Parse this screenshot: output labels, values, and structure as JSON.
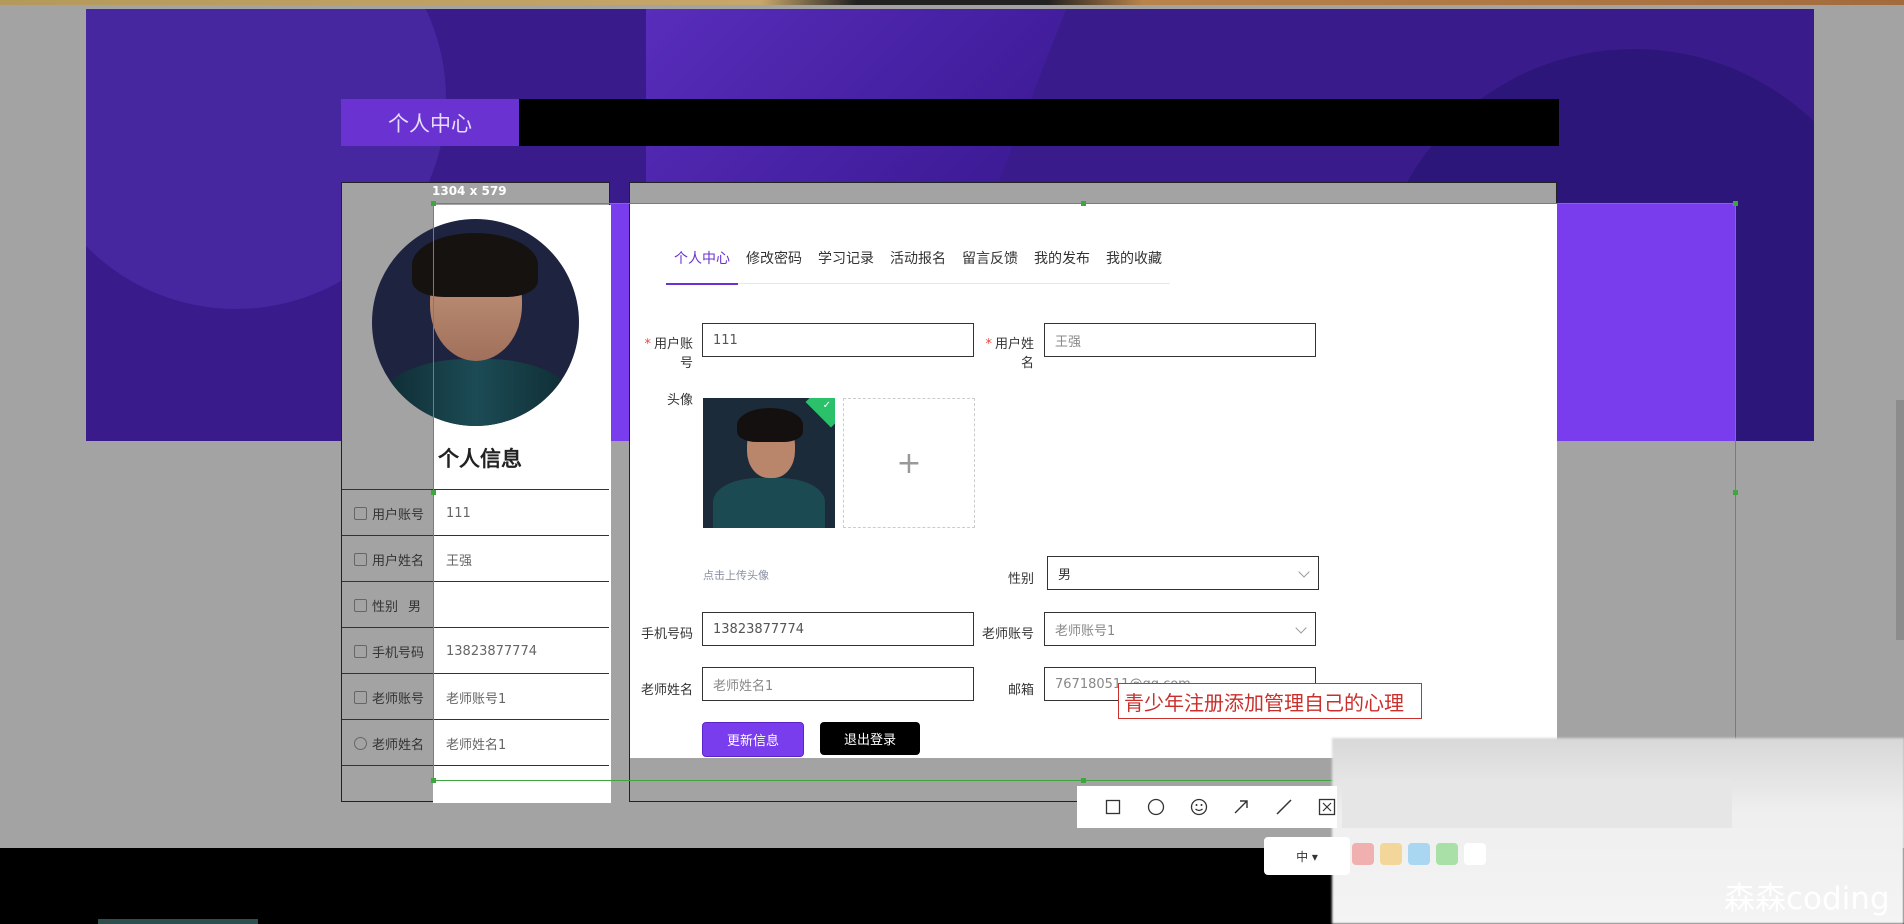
{
  "header": {
    "title": "个人中心"
  },
  "screenshot_tool": {
    "size_label": "1304 x 579",
    "annotation_text": "青少年注册添加管理自己的心理",
    "toolbar_icons": [
      "rectangle-icon",
      "circle-icon",
      "emoji-icon",
      "arrow-icon",
      "line-icon",
      "mosaic-icon"
    ],
    "lang_label": "中 ▾"
  },
  "profile": {
    "section_title": "个人信息",
    "rows": [
      {
        "label": "用户账号",
        "value": "111",
        "icon": "user-icon"
      },
      {
        "label": "用户姓名",
        "value": "王强",
        "icon": "id-card-icon"
      },
      {
        "label": "性别",
        "value": "男",
        "icon": "chat-icon"
      },
      {
        "label": "手机号码",
        "value": "13823877774",
        "icon": "edit-icon"
      },
      {
        "label": "老师账号",
        "value": "老师账号1",
        "icon": "person-icon"
      },
      {
        "label": "老师姓名",
        "value": "老师姓名1",
        "icon": "clock-icon"
      }
    ]
  },
  "tabs": [
    {
      "label": "个人中心",
      "active": true
    },
    {
      "label": "修改密码",
      "active": false
    },
    {
      "label": "学习记录",
      "active": false
    },
    {
      "label": "活动报名",
      "active": false
    },
    {
      "label": "留言反馈",
      "active": false
    },
    {
      "label": "我的发布",
      "active": false
    },
    {
      "label": "我的收藏",
      "active": false
    }
  ],
  "form": {
    "account_label": "用户账号",
    "account_value": "111",
    "name_label": "用户姓名",
    "name_value": "王强",
    "avatar_label": "头像",
    "upload_plus": "+",
    "upload_tip": "点击上传头像",
    "gender_label": "性别",
    "gender_value": "男",
    "phone_label": "手机号码",
    "phone_value": "13823877774",
    "teacher_account_label": "老师账号",
    "teacher_account_value": "老师账号1",
    "teacher_name_label": "老师姓名",
    "teacher_name_value": "老师姓名1",
    "email_label": "邮箱",
    "email_value": "767180511@qq.com",
    "required_mark": "*",
    "update_button": "更新信息",
    "logout_button": "退出登录"
  },
  "watermark": "森森coding"
}
